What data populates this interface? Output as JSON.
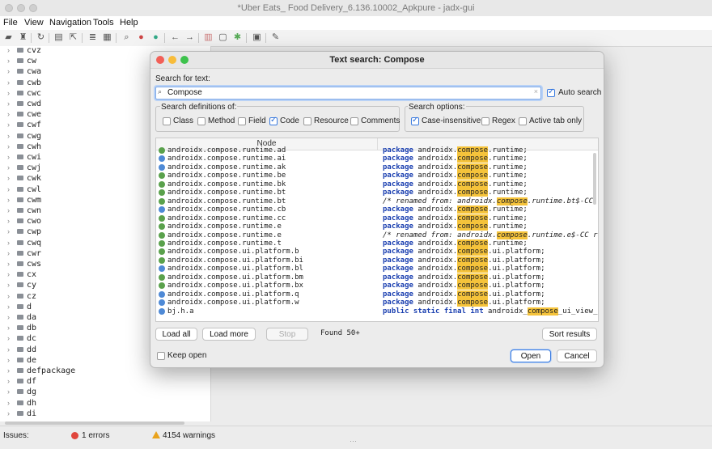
{
  "window": {
    "title": "*Uber Eats_ Food Delivery_6.136.10002_Apkpure - jadx-gui"
  },
  "menubar": [
    "File",
    "View",
    "Navigation",
    "Tools",
    "Help"
  ],
  "toolbar_icons": [
    "open-folder-icon",
    "save-all-icon",
    "sync-icon",
    "save-icon",
    "export-icon",
    "flatten-icon",
    "deobfuscate-icon",
    "search-icon",
    "search-class-icon",
    "search-usage-icon",
    "back-icon",
    "forward-icon",
    "log-icon",
    "preferences-icon",
    "debug-icon",
    "quark-icon",
    "settings-icon"
  ],
  "tree": {
    "items": [
      "cvz",
      "cw",
      "cwa",
      "cwb",
      "cwc",
      "cwd",
      "cwe",
      "cwf",
      "cwg",
      "cwh",
      "cwi",
      "cwj",
      "cwk",
      "cwl",
      "cwm",
      "cwn",
      "cwo",
      "cwp",
      "cwq",
      "cwr",
      "cws",
      "cx",
      "cy",
      "cz",
      "d",
      "da",
      "db",
      "dc",
      "dd",
      "de",
      "defpackage",
      "df",
      "dg",
      "dh",
      "di"
    ]
  },
  "status": {
    "issues_label": "Issues:",
    "errors": "1 errors",
    "warnings": "4154 warnings"
  },
  "dialog": {
    "title": "Text search: Compose",
    "search_label": "Search for text:",
    "search_value": "Compose",
    "auto_search_label": "Auto search",
    "auto_search_checked": true,
    "definitions_title": "Search definitions of:",
    "definitions": [
      {
        "label": "Class",
        "checked": false
      },
      {
        "label": "Method",
        "checked": false
      },
      {
        "label": "Field",
        "checked": false
      },
      {
        "label": "Code",
        "checked": true
      },
      {
        "label": "Resource",
        "checked": false
      },
      {
        "label": "Comments",
        "checked": false
      }
    ],
    "options_title": "Search options:",
    "options": [
      {
        "label": "Case-insensitive",
        "checked": true
      },
      {
        "label": "Regex",
        "checked": false
      },
      {
        "label": "Active tab only",
        "checked": false
      }
    ],
    "results_header": "Node",
    "results": [
      {
        "icon": "i",
        "node": "androidx.compose.runtime.ad",
        "pre": "",
        "kw": "package",
        "mid": " androidx.",
        "hl": "compose",
        "post": ".runtime;",
        "comment": false
      },
      {
        "icon": "c",
        "node": "androidx.compose.runtime.ai",
        "pre": "",
        "kw": "package",
        "mid": " androidx.",
        "hl": "compose",
        "post": ".runtime;",
        "comment": false
      },
      {
        "icon": "c",
        "node": "androidx.compose.runtime.ak",
        "pre": "",
        "kw": "package",
        "mid": " androidx.",
        "hl": "compose",
        "post": ".runtime;",
        "comment": false
      },
      {
        "icon": "i",
        "node": "androidx.compose.runtime.be",
        "pre": "",
        "kw": "package",
        "mid": " androidx.",
        "hl": "compose",
        "post": ".runtime;",
        "comment": false
      },
      {
        "icon": "i",
        "node": "androidx.compose.runtime.bk",
        "pre": "",
        "kw": "package",
        "mid": " androidx.",
        "hl": "compose",
        "post": ".runtime;",
        "comment": false
      },
      {
        "icon": "i",
        "node": "androidx.compose.runtime.bt",
        "pre": "",
        "kw": "package",
        "mid": " androidx.",
        "hl": "compose",
        "post": ".runtime;",
        "comment": false
      },
      {
        "icon": "i",
        "node": "androidx.compose.runtime.bt",
        "pre": "/* renamed from: androidx.",
        "kw": "",
        "mid": "",
        "hl": "compose",
        "post": ".runtime.bt$-CC  rea",
        "comment": true
      },
      {
        "icon": "c",
        "node": "androidx.compose.runtime.cb",
        "pre": "",
        "kw": "package",
        "mid": " androidx.",
        "hl": "compose",
        "post": ".runtime;",
        "comment": false
      },
      {
        "icon": "i",
        "node": "androidx.compose.runtime.cc",
        "pre": "",
        "kw": "package",
        "mid": " androidx.",
        "hl": "compose",
        "post": ".runtime;",
        "comment": false
      },
      {
        "icon": "i",
        "node": "androidx.compose.runtime.e",
        "pre": "",
        "kw": "package",
        "mid": " androidx.",
        "hl": "compose",
        "post": ".runtime;",
        "comment": false
      },
      {
        "icon": "i",
        "node": "androidx.compose.runtime.e",
        "pre": "/* renamed from: androidx.",
        "kw": "",
        "mid": "",
        "hl": "compose",
        "post": ".runtime.e$-CC  reas",
        "comment": true
      },
      {
        "icon": "i",
        "node": "androidx.compose.runtime.t",
        "pre": "",
        "kw": "package",
        "mid": " androidx.",
        "hl": "compose",
        "post": ".runtime;",
        "comment": false
      },
      {
        "icon": "i",
        "node": "androidx.compose.ui.platform.b",
        "pre": "",
        "kw": "package",
        "mid": " androidx.",
        "hl": "compose",
        "post": ".ui.platform;",
        "comment": false
      },
      {
        "icon": "i",
        "node": "androidx.compose.ui.platform.bi",
        "pre": "",
        "kw": "package",
        "mid": " androidx.",
        "hl": "compose",
        "post": ".ui.platform;",
        "comment": false
      },
      {
        "icon": "c",
        "node": "androidx.compose.ui.platform.bl",
        "pre": "",
        "kw": "package",
        "mid": " androidx.",
        "hl": "compose",
        "post": ".ui.platform;",
        "comment": false
      },
      {
        "icon": "i",
        "node": "androidx.compose.ui.platform.bm",
        "pre": "",
        "kw": "package",
        "mid": " androidx.",
        "hl": "compose",
        "post": ".ui.platform;",
        "comment": false
      },
      {
        "icon": "i",
        "node": "androidx.compose.ui.platform.bx",
        "pre": "",
        "kw": "package",
        "mid": " androidx.",
        "hl": "compose",
        "post": ".ui.platform;",
        "comment": false
      },
      {
        "icon": "c",
        "node": "androidx.compose.ui.platform.q",
        "pre": "",
        "kw": "package",
        "mid": " androidx.",
        "hl": "compose",
        "post": ".ui.platform;",
        "comment": false
      },
      {
        "icon": "c",
        "node": "androidx.compose.ui.platform.w",
        "pre": "",
        "kw": "package",
        "mid": " androidx.",
        "hl": "compose",
        "post": ".ui.platform;",
        "comment": false
      },
      {
        "icon": "c",
        "node": "bj.h.a",
        "pre": "",
        "kw": "public static final int",
        "mid": " androidx_",
        "hl": "compose",
        "post": "_ui_view_comp",
        "comment": false
      }
    ],
    "buttons": {
      "load_all": "Load all",
      "load_more": "Load more",
      "stop": "Stop",
      "sort": "Sort results",
      "open": "Open",
      "cancel": "Cancel"
    },
    "found_text": "Found 50+",
    "keep_open_label": "Keep open",
    "keep_open_checked": false
  }
}
